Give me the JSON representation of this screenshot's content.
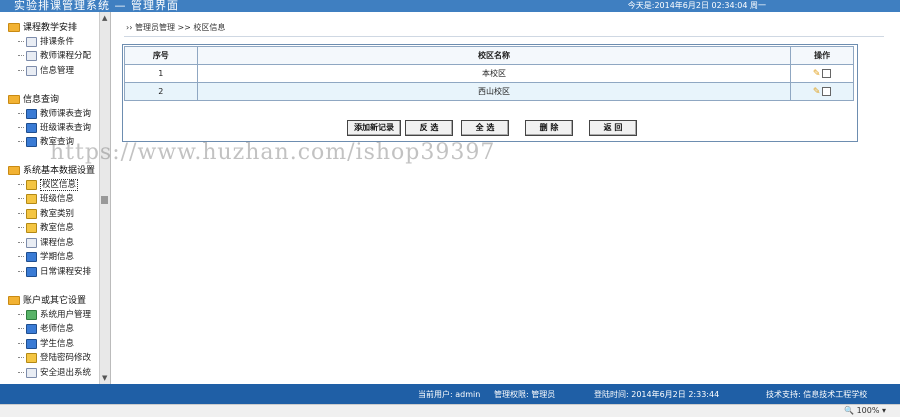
{
  "header": {
    "title": "实验排课管理系统 — 管理界面",
    "date": "今天是:2014年6月2日  02:34:04  周一"
  },
  "sidebar": {
    "groups": [
      {
        "title": "课程教学安排",
        "items": [
          {
            "label": "排课条件",
            "icon": "doc-icon"
          },
          {
            "label": "教师课程分配",
            "icon": "doc-icon"
          },
          {
            "label": "信息管理",
            "icon": "doc-icon"
          }
        ]
      },
      {
        "title": "信息查询",
        "items": [
          {
            "label": "教师课表查询",
            "icon": "edit-icon"
          },
          {
            "label": "班级课表查询",
            "icon": "edit-icon"
          },
          {
            "label": "教室查询",
            "icon": "edit-icon"
          }
        ]
      },
      {
        "title": "系统基本数据设置",
        "items": [
          {
            "label": "校区信息",
            "icon": "edit-icon",
            "active": true
          },
          {
            "label": "班级信息",
            "icon": "edit-icon"
          },
          {
            "label": "教室类别",
            "icon": "edit-icon"
          },
          {
            "label": "教室信息",
            "icon": "edit-icon"
          },
          {
            "label": "课程信息",
            "icon": "doc-icon"
          },
          {
            "label": "学期信息",
            "icon": "edit-icon"
          },
          {
            "label": "日常课程安排",
            "icon": "edit-icon"
          }
        ]
      },
      {
        "title": "账户或其它设置",
        "items": [
          {
            "label": "系统用户管理",
            "icon": "users-icon"
          },
          {
            "label": "老师信息",
            "icon": "edit-icon"
          },
          {
            "label": "学生信息",
            "icon": "edit-icon"
          },
          {
            "label": "登陆密码修改",
            "icon": "key-icon"
          },
          {
            "label": "安全退出系统",
            "icon": "exit-icon"
          }
        ]
      }
    ]
  },
  "breadcrumb": "›› 管理员管理  >> 校区信息",
  "table": {
    "headers": [
      "序号",
      "校区名称",
      "操作"
    ],
    "rows": [
      {
        "id": "1",
        "name": "本校区"
      },
      {
        "id": "2",
        "name": "西山校区"
      }
    ]
  },
  "buttons": {
    "add": "添加新记录",
    "invert": "反 选",
    "all": "全 选",
    "delete": "删 除",
    "back": "返 回"
  },
  "watermark": "https://www.huzhan.com/ishop39397",
  "footer": {
    "user": "当前用户: admin",
    "role": "管理权限: 管理员",
    "login_time": "登陆时间: 2014年6月2日 2:33:44",
    "support": "技术支持: 信息技术工程学校"
  },
  "statusbar": {
    "zoom": "100%"
  }
}
